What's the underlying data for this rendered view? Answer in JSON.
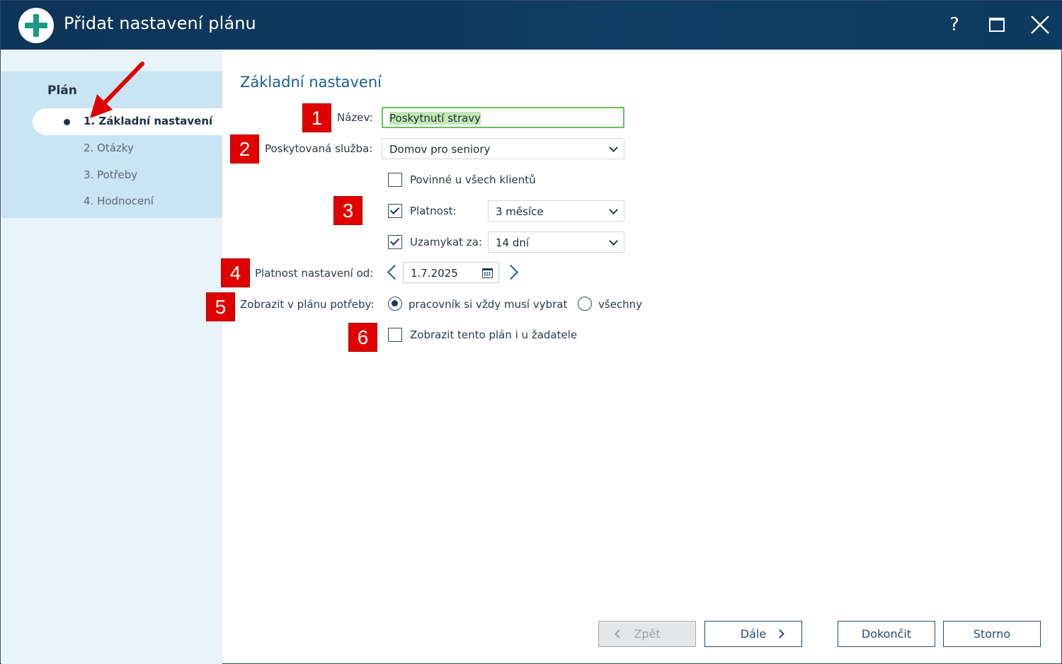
{
  "window": {
    "title": "Přidat nastavení plánu",
    "help_label": "?"
  },
  "sidebar": {
    "heading": "Plán",
    "steps": [
      {
        "label": "1. Základní nastavení",
        "active": true
      },
      {
        "label": "2. Otázky",
        "active": false
      },
      {
        "label": "3. Potřeby",
        "active": false
      },
      {
        "label": "4. Hodnocení",
        "active": false
      }
    ]
  },
  "main": {
    "section_title": "Základní nastavení",
    "name": {
      "label": "Název:",
      "value": "Poskytnutí stravy"
    },
    "service": {
      "label": "Poskytovaná služba:",
      "value": "Domov pro seniory"
    },
    "mandatory": {
      "label": "Povinné u všech klientů",
      "checked": false
    },
    "validity": {
      "label": "Platnost:",
      "checked": true,
      "value": "3 měsíce"
    },
    "lock": {
      "label": "Uzamykat za:",
      "checked": true,
      "value": "14 dní"
    },
    "valid_from": {
      "label": "Platnost nastavení od:",
      "value": "1.7.2025"
    },
    "show_needs": {
      "label": "Zobrazit v plánu potřeby:",
      "options": [
        {
          "label": "pracovník si vždy musí vybrat",
          "selected": true
        },
        {
          "label": "všechny",
          "selected": false
        }
      ]
    },
    "show_applicant": {
      "label": "Zobrazit tento plán i u žadatele",
      "checked": false
    }
  },
  "annotations": {
    "badges": [
      "1",
      "2",
      "3",
      "4",
      "5",
      "6"
    ],
    "arrow_color": "#e00000"
  },
  "footer": {
    "back_label": "Zpět",
    "next_label": "Dále",
    "finish_label": "Dokončit",
    "cancel_label": "Storno"
  },
  "colors": {
    "titlebar": "#0f3d64",
    "accent": "#1a5f96",
    "sidebar_panel": "#c9e4f3",
    "focus_border": "#6bbf5e",
    "badge": "#e00000"
  }
}
